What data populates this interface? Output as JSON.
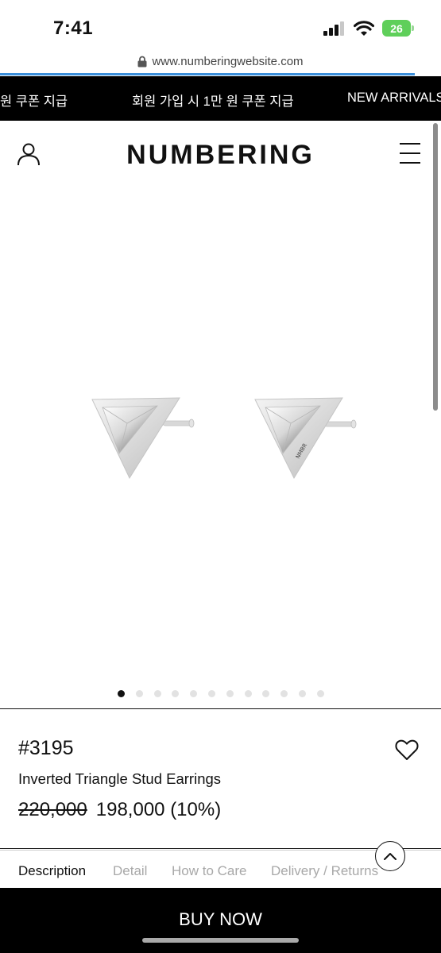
{
  "status_bar": {
    "time": "7:41",
    "battery": "26"
  },
  "browser": {
    "url": "www.numberingwebsite.com"
  },
  "banner": {
    "items": [
      "원 쿠폰 지급",
      "회원 가입 시 1만 원 쿠폰 지급",
      "NEW ARRIVALS"
    ]
  },
  "header": {
    "logo": "NUMBERING"
  },
  "gallery": {
    "image_count": 12,
    "active_index": 0,
    "engraving": "NMBR"
  },
  "product": {
    "sku": "#3195",
    "name": "Inverted Triangle Stud Earrings",
    "original_price": "220,000",
    "sale_price": "198,000 (10%)"
  },
  "tabs": [
    "Description",
    "Detail",
    "How to Care",
    "Delivery / Returns"
  ],
  "buy_button": {
    "label": "BUY NOW"
  },
  "icons": {
    "user": "user-icon",
    "menu": "hamburger-menu-icon",
    "wishlist": "heart-icon",
    "scroll_top": "chevron-up-icon",
    "lock": "lock-icon"
  },
  "colors": {
    "banner_bg": "#000000",
    "buy_bg": "#000000",
    "load_bar": "#3b8fdb",
    "battery": "#5fcf5a"
  }
}
